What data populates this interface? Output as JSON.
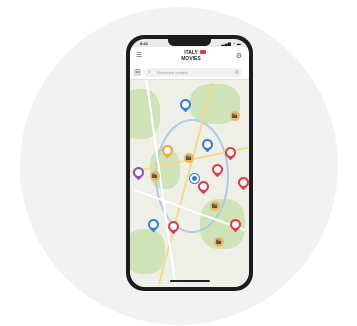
{
  "app": {
    "logo_line1": "ITALY",
    "logo_line2": "MOVIES"
  },
  "status_bar": {
    "time": "9:41",
    "icons": "▂▄▆ ◔ ▬"
  },
  "header": {
    "menu_icon": "menu-icon",
    "settings_icon": "gear-icon"
  },
  "search": {
    "placeholder": "Ricercare località",
    "filter_icon": "filter-icon",
    "search_icon": "search-icon",
    "location_icon": "locate-icon"
  },
  "colors": {
    "map_bg": "#eef0e8",
    "pin_blue": "#2f7fe0",
    "pin_red": "#e63946",
    "pin_orange": "#f2a33a",
    "pin_purple": "#8b4fc2",
    "camera_marker": "#f1b84a"
  }
}
